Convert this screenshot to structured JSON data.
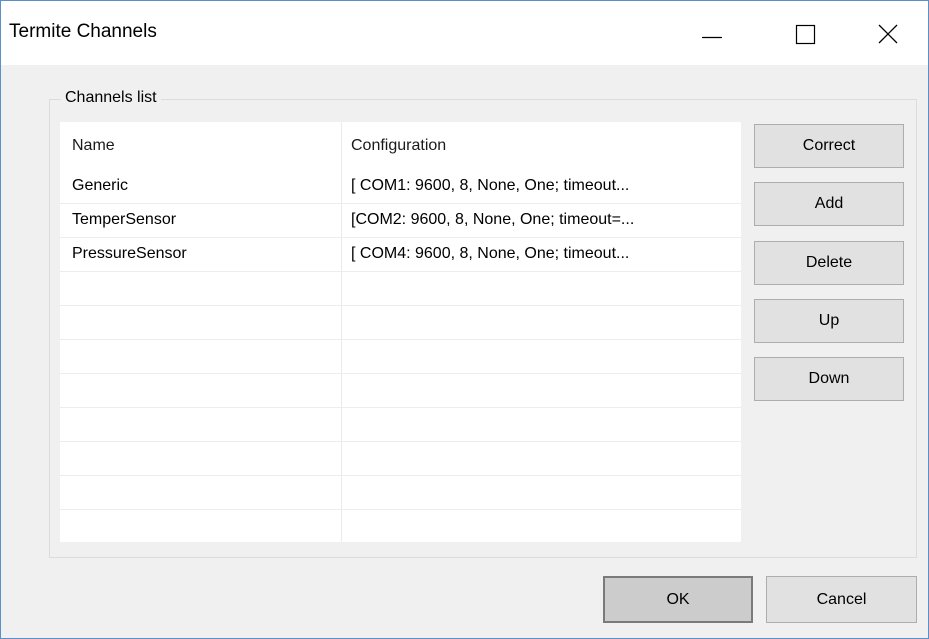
{
  "window": {
    "title": "Termite Channels"
  },
  "group": {
    "label": "Channels list"
  },
  "list": {
    "columns": [
      "Name",
      "Configuration"
    ],
    "rows": [
      {
        "name": "Generic",
        "configuration": "[ COM1: 9600, 8, None, One; timeout..."
      },
      {
        "name": "TemperSensor",
        "configuration": "[COM2: 9600, 8, None, One; timeout=..."
      },
      {
        "name": "PressureSensor",
        "configuration": "[ COM4: 9600, 8, None, One; timeout..."
      },
      {
        "name": "",
        "configuration": ""
      },
      {
        "name": "",
        "configuration": ""
      },
      {
        "name": "",
        "configuration": ""
      },
      {
        "name": "",
        "configuration": ""
      },
      {
        "name": "",
        "configuration": ""
      },
      {
        "name": "",
        "configuration": ""
      },
      {
        "name": "",
        "configuration": ""
      },
      {
        "name": "",
        "configuration": ""
      }
    ]
  },
  "buttons": {
    "correct": "Correct",
    "add": "Add",
    "delete": "Delete",
    "up": "Up",
    "down": "Down",
    "ok": "OK",
    "cancel": "Cancel"
  },
  "titlebar_icons": {
    "minimize": "minimize-icon",
    "maximize": "maximize-icon",
    "close": "close-icon"
  },
  "colors": {
    "window_border": "#5b8fc7",
    "dialog_bg": "#f0f0f0",
    "button_bg": "#e1e1e1",
    "default_button_bg": "#cccccc"
  }
}
